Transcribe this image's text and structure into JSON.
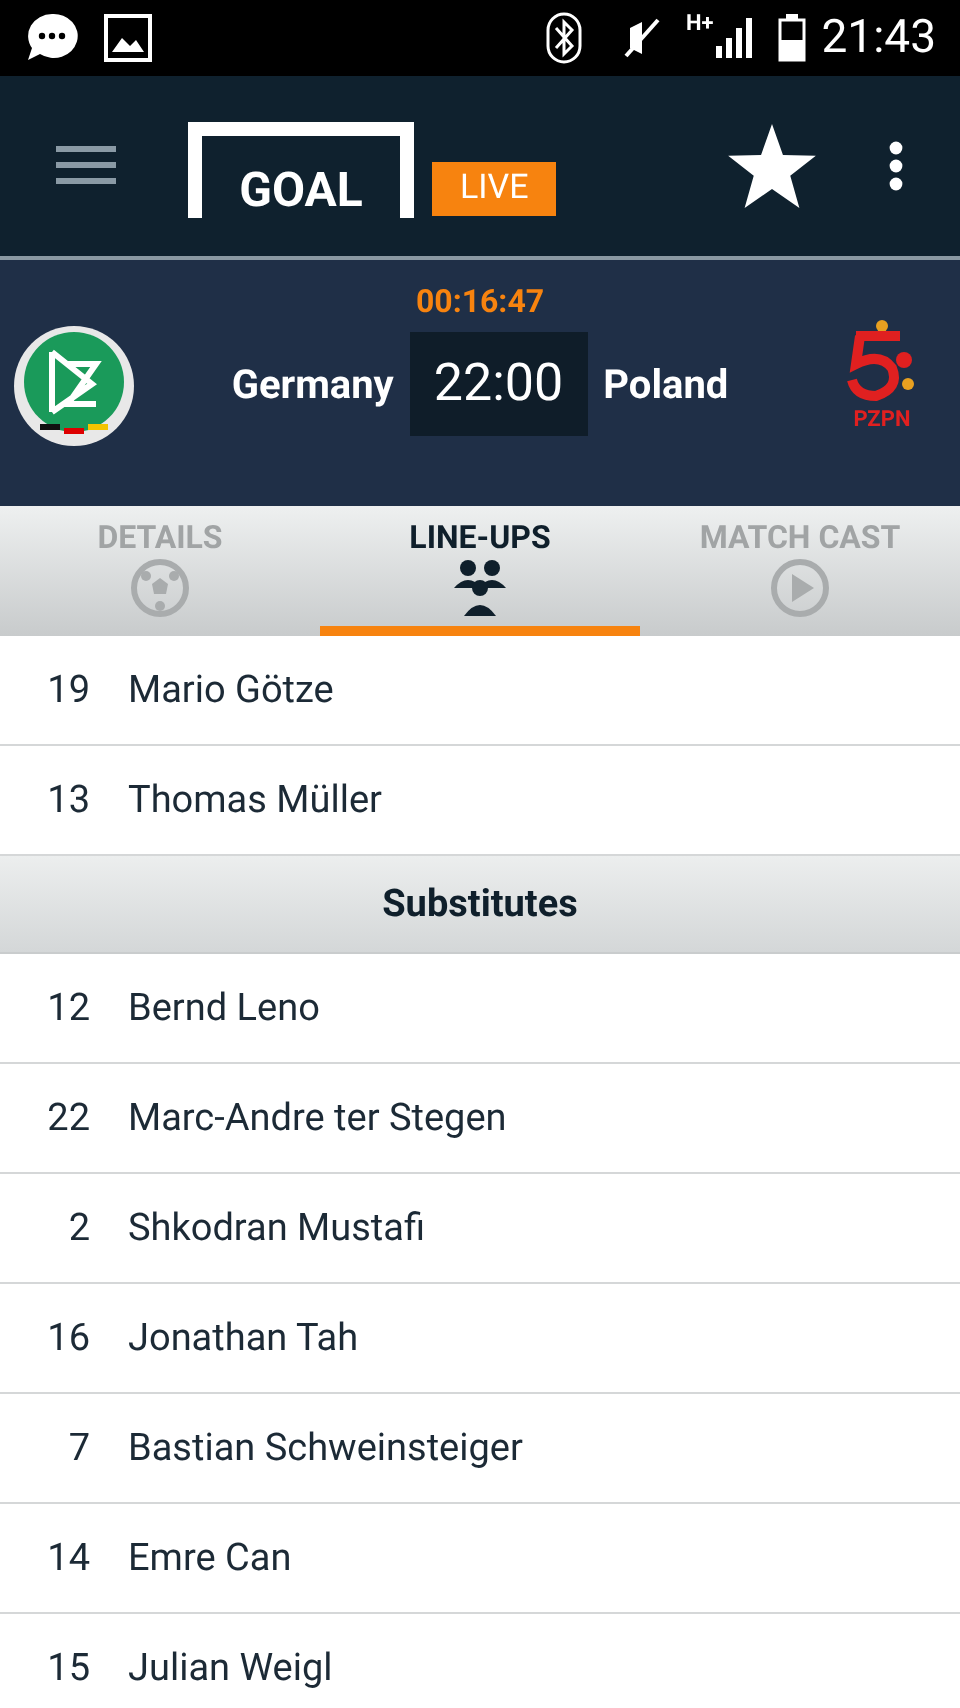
{
  "status_bar": {
    "time": "21:43",
    "network": "H+"
  },
  "app_bar": {
    "logo_text": "GOAL",
    "live_badge": "LIVE"
  },
  "match": {
    "timer": "00:16:47",
    "home": "Germany",
    "score": "22:00",
    "away": "Poland",
    "away_badge_text": "PZPN"
  },
  "tabs": [
    {
      "label": "DETAILS",
      "kind": "ball",
      "selected": false
    },
    {
      "label": "LINE-UPS",
      "kind": "people",
      "selected": true
    },
    {
      "label": "MATCH CAST",
      "kind": "play",
      "selected": false
    }
  ],
  "lineup": [
    {
      "kind": "player",
      "number": "19",
      "name": "Mario Götze"
    },
    {
      "kind": "player",
      "number": "13",
      "name": "Thomas Müller"
    },
    {
      "kind": "header",
      "name": "Substitutes"
    },
    {
      "kind": "player",
      "number": "12",
      "name": "Bernd Leno"
    },
    {
      "kind": "player",
      "number": "22",
      "name": "Marc-Andre ter Stegen"
    },
    {
      "kind": "player",
      "number": "2",
      "name": "Shkodran Mustafi"
    },
    {
      "kind": "player",
      "number": "16",
      "name": "Jonathan Tah"
    },
    {
      "kind": "player",
      "number": "7",
      "name": "Bastian Schweinsteiger"
    },
    {
      "kind": "player",
      "number": "14",
      "name": "Emre Can"
    },
    {
      "kind": "player",
      "number": "15",
      "name": "Julian Weigl"
    }
  ]
}
